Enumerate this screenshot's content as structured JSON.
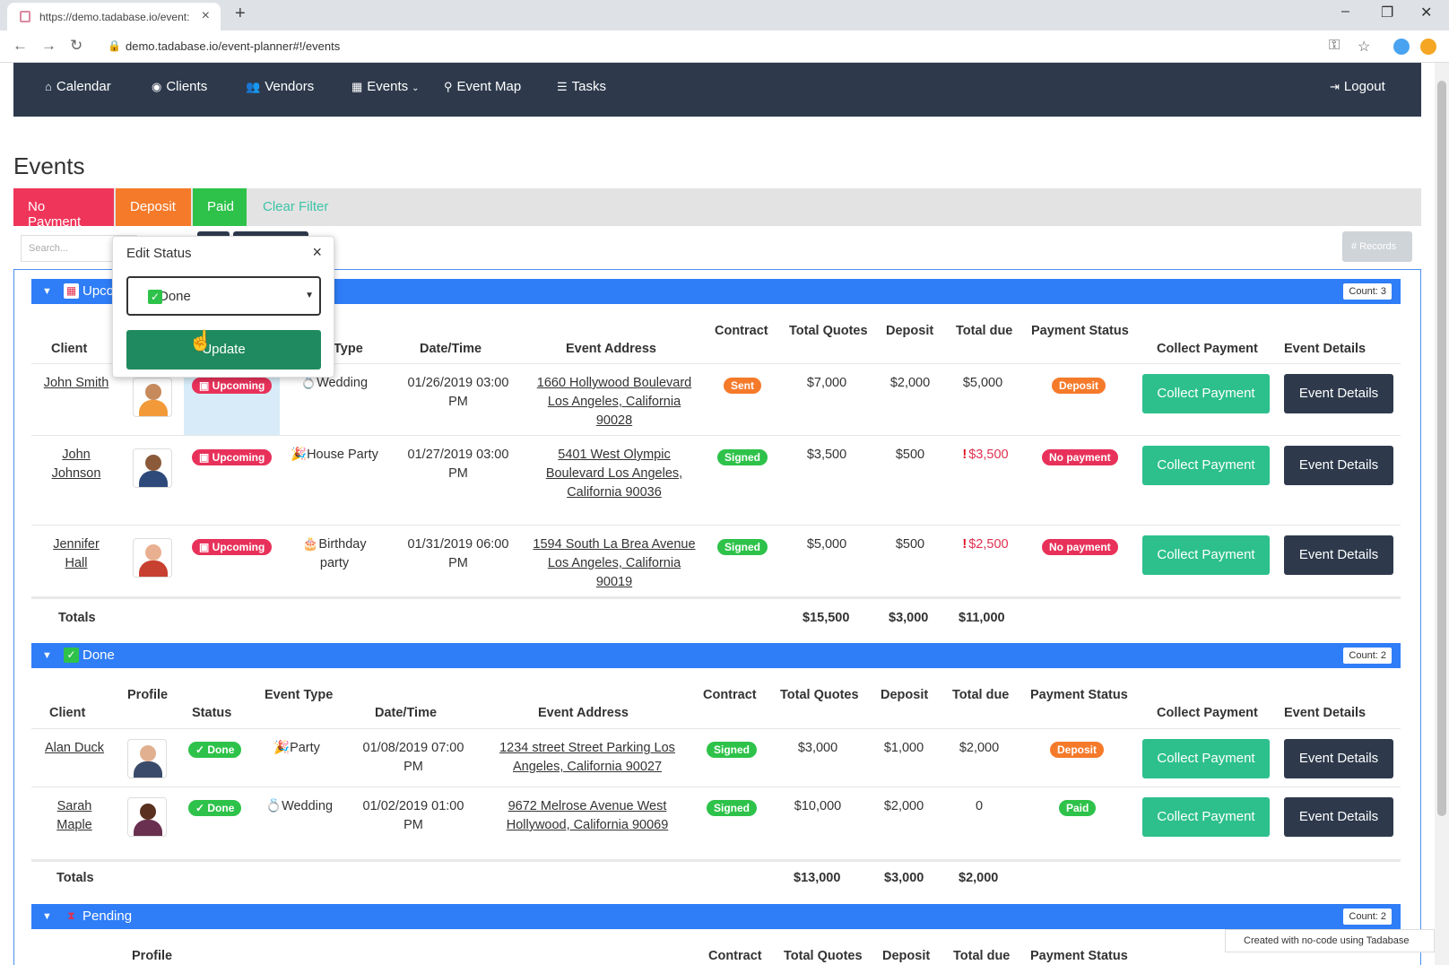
{
  "browser": {
    "tab_title": "https://demo.tadabase.io/event:",
    "url": "demo.tadabase.io/event-planner#!/events"
  },
  "nav": {
    "calendar": "Calendar",
    "clients": "Clients",
    "vendors": "Vendors",
    "events": "Events",
    "event_map": "Event Map",
    "tasks": "Tasks",
    "logout": "Logout"
  },
  "page_title": "Events",
  "filters": {
    "no_payment": "No Payment",
    "deposit": "Deposit",
    "paid": "Paid",
    "clear": "Clear Filter"
  },
  "search_placeholder": "Search...",
  "records_button": "# Records",
  "popup": {
    "title": "Edit Status",
    "selected": "Done",
    "update_label": "Update"
  },
  "headers": {
    "client": "Client",
    "profile": "Profile",
    "status": "Status",
    "event_type": "Event Type",
    "type": "Type",
    "datetime": "Date/Time",
    "address": "Event Address",
    "contract": "Contract",
    "total_quotes": "Total Quotes",
    "deposit": "Deposit",
    "total_due": "Total due",
    "payment_status": "Payment Status",
    "collect_payment": "Collect Payment",
    "event_details": "Event Details"
  },
  "groups": {
    "upcoming": {
      "label": "Upco",
      "count": "Count: 3",
      "rows": [
        {
          "client": "John Smith",
          "status": "Upcoming",
          "type": "Wedding",
          "datetime": "01/26/2019 03:00 PM",
          "address": "1660 Hollywood Boulevard Los Angeles, California 90028",
          "contract": "Sent",
          "quotes": "$7,000",
          "deposit": "$2,000",
          "due": "$5,000",
          "payment": "Deposit"
        },
        {
          "client": "John Johnson",
          "status": "Upcoming",
          "type": "House Party",
          "datetime": "01/27/2019 03:00 PM",
          "address": "5401 West Olympic Boulevard Los Angeles, California 90036",
          "contract": "Signed",
          "quotes": "$3,500",
          "deposit": "$500",
          "due": "$3,500",
          "payment": "No payment"
        },
        {
          "client": "Jennifer Hall",
          "status": "Upcoming",
          "type": "Birthday party",
          "datetime": "01/31/2019 06:00 PM",
          "address": "1594 South La Brea Avenue Los Angeles, California 90019",
          "contract": "Signed",
          "quotes": "$5,000",
          "deposit": "$500",
          "due": "$2,500",
          "payment": "No payment"
        }
      ],
      "totals": {
        "label": "Totals",
        "quotes": "$15,500",
        "deposit": "$3,000",
        "due": "$11,000"
      }
    },
    "done": {
      "label": "Done",
      "count": "Count: 2",
      "rows": [
        {
          "client": "Alan Duck",
          "status": "Done",
          "type": "Party",
          "datetime": "01/08/2019 07:00 PM",
          "address": "1234 street Street Parking Los Angeles, California 90027",
          "contract": "Signed",
          "quotes": "$3,000",
          "deposit": "$1,000",
          "due": "$2,000",
          "payment": "Deposit"
        },
        {
          "client": "Sarah Maple",
          "status": "Done",
          "type": "Wedding",
          "datetime": "01/02/2019 01:00 PM",
          "address": "9672 Melrose Avenue West Hollywood, California 90069",
          "contract": "Signed",
          "quotes": "$10,000",
          "deposit": "$2,000",
          "due": "0",
          "payment": "Paid"
        }
      ],
      "totals": {
        "label": "Totals",
        "quotes": "$13,000",
        "deposit": "$3,000",
        "due": "$2,000"
      }
    },
    "pending": {
      "label": "Pending",
      "count": "Count: 2"
    }
  },
  "buttons": {
    "collect": "Collect Payment",
    "details": "Event Details"
  },
  "footer_text": "Created with no-code using Tadabase",
  "colors": {
    "nav_bg": "#2e3a4c",
    "group_bar": "#2f7df7",
    "no_payment": "#f0355a",
    "deposit": "#f57a2a",
    "paid": "#2ec24a",
    "collect": "#2dc08d"
  }
}
